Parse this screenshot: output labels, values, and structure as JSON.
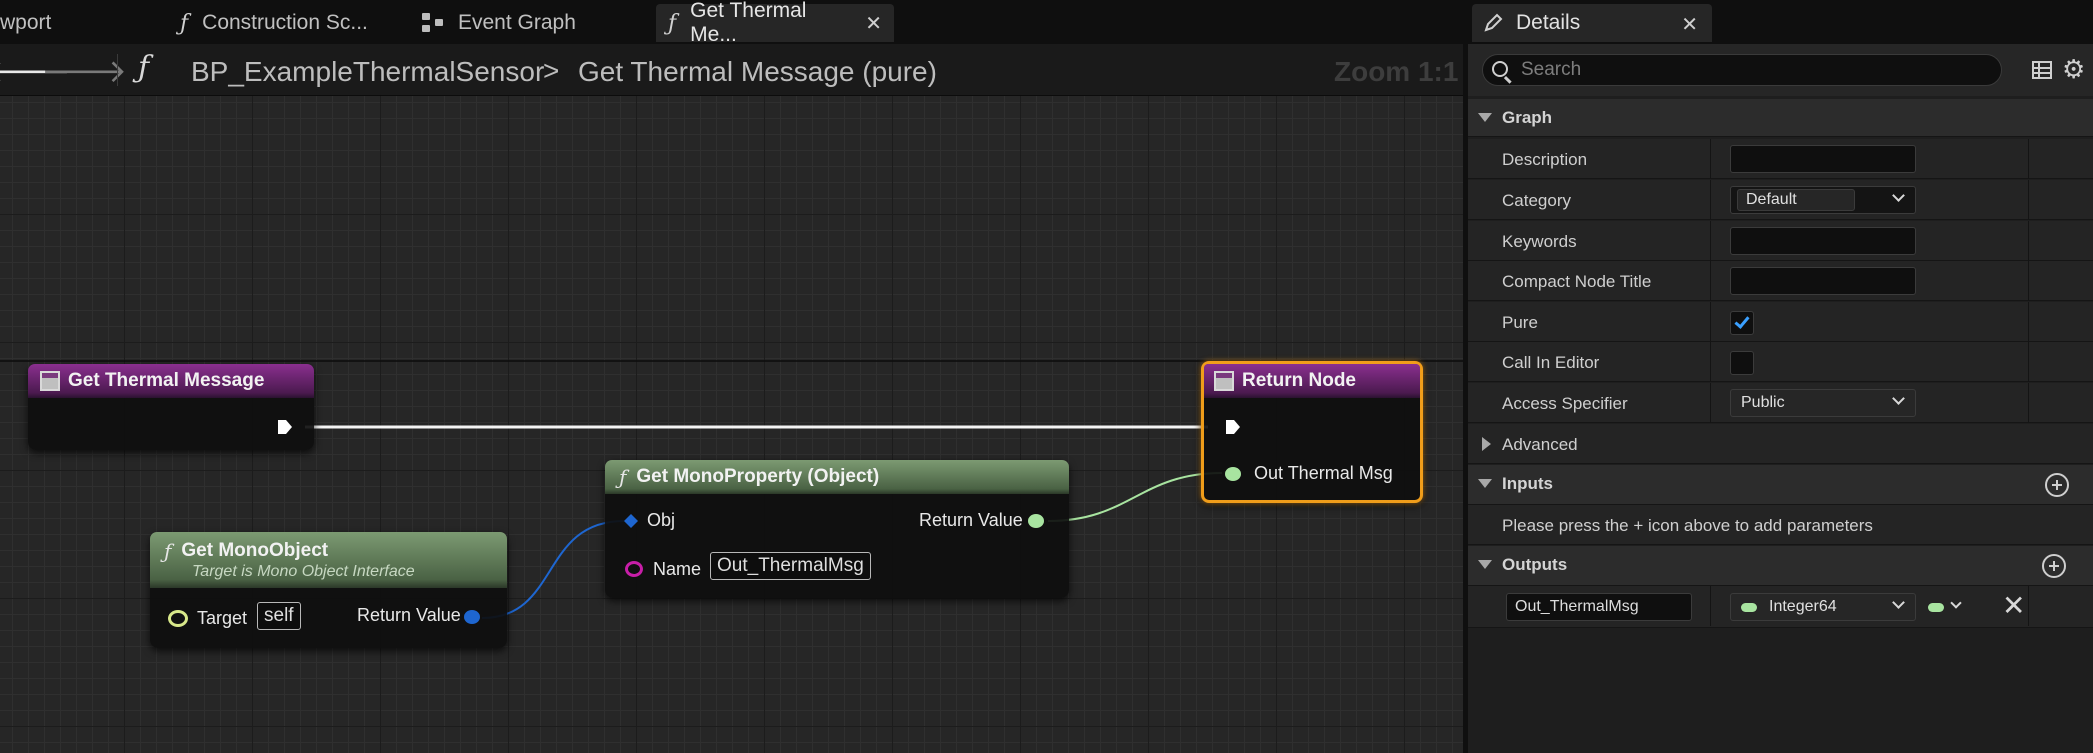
{
  "tabs": [
    {
      "label": "wport",
      "icon": "viewport-icon",
      "active": false
    },
    {
      "label": "Construction Sc...",
      "icon": "function-icon",
      "active": false
    },
    {
      "label": "Event Graph",
      "icon": "event-graph-icon",
      "active": false
    },
    {
      "label": "Get Thermal Me...",
      "icon": "function-icon",
      "active": true
    }
  ],
  "breadcrumb": {
    "function_glyph": "ƒ",
    "blueprint": "BP_ExampleThermalSensor",
    "separator": ">",
    "function": "Get Thermal Message (pure)",
    "zoom": "Zoom 1:1"
  },
  "graph": {
    "nodes": {
      "entry": {
        "title": "Get Thermal Message"
      },
      "return": {
        "title": "Return Node",
        "pins": {
          "out_thermal_msg": "Out Thermal Msg"
        }
      },
      "get_mono_property": {
        "title": "Get MonoProperty (Object)",
        "pins": {
          "obj": "Obj",
          "name": "Name",
          "name_value": "Out_ThermalMsg",
          "return_value": "Return Value"
        }
      },
      "get_mono_object": {
        "title": "Get MonoObject",
        "subtitle": "Target is Mono Object Interface",
        "pins": {
          "target": "Target",
          "target_value": "self",
          "return_value": "Return Value"
        }
      }
    },
    "colors": {
      "exec": "#ffffff",
      "object": "#0070e0",
      "name": "#c81ea8",
      "int64": "#a8e4a0",
      "selection": "#f09d1a"
    }
  },
  "details": {
    "tab_title": "Details",
    "search_placeholder": "Search",
    "sections": {
      "graph": "Graph",
      "advanced": "Advanced",
      "inputs": "Inputs",
      "outputs": "Outputs"
    },
    "properties": {
      "description": {
        "label": "Description",
        "value": ""
      },
      "category": {
        "label": "Category",
        "value": "Default"
      },
      "keywords": {
        "label": "Keywords",
        "value": ""
      },
      "compact_node_title": {
        "label": "Compact Node Title",
        "value": ""
      },
      "pure": {
        "label": "Pure",
        "checked": true
      },
      "call_in_editor": {
        "label": "Call In Editor",
        "checked": false
      },
      "access_specifier": {
        "label": "Access Specifier",
        "value": "Public"
      }
    },
    "inputs_hint": "Please press the + icon above to add parameters",
    "outputs": [
      {
        "name": "Out_ThermalMsg",
        "type": "Integer64"
      }
    ]
  }
}
